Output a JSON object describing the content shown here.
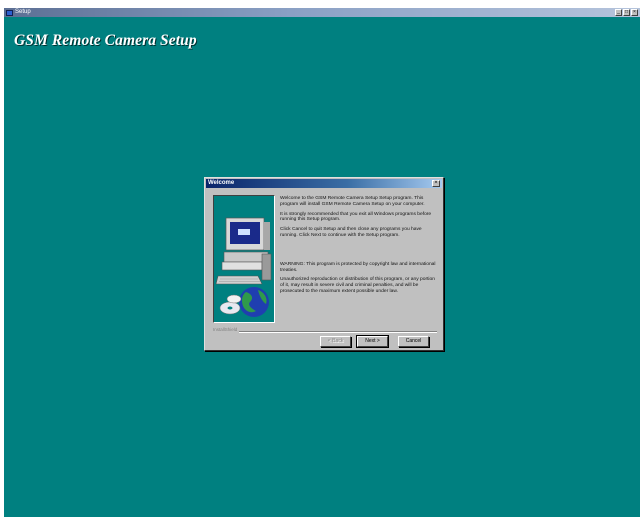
{
  "window": {
    "title": "Setup",
    "controls": {
      "minimize": "_",
      "maximize": "□",
      "close": "×"
    }
  },
  "app": {
    "title": "GSM Remote Camera Setup"
  },
  "dialog": {
    "title": "Welcome",
    "close": "×",
    "paragraphs": [
      "Welcome to the GSM Remote Camera Setup Setup program. This program will install GSM Remote Camera Setup on your computer.",
      "It is strongly recommended that you exit all Windows programs before running this Setup program.",
      "Click Cancel to quit Setup and then close any programs you have running. Click Next to continue with the Setup program.",
      "WARNING: This program is protected by copyright law and international treaties.",
      "Unauthorized reproduction or distribution of this program, or any portion of it, may result in severe civil and criminal penalties, and will be prosecuted to the maximum extent possible under law."
    ],
    "footer_label": "InstallShield",
    "buttons": {
      "back": "< Back",
      "next": "Next >",
      "cancel": "Cancel"
    }
  },
  "colors": {
    "desktop": "#008080",
    "dialog_face": "#c0c0c0",
    "dialog_title": "#0a246a"
  },
  "icons": [
    "setup-app-icon",
    "computer-illustration",
    "globe-icon",
    "cd-disc-icon"
  ]
}
